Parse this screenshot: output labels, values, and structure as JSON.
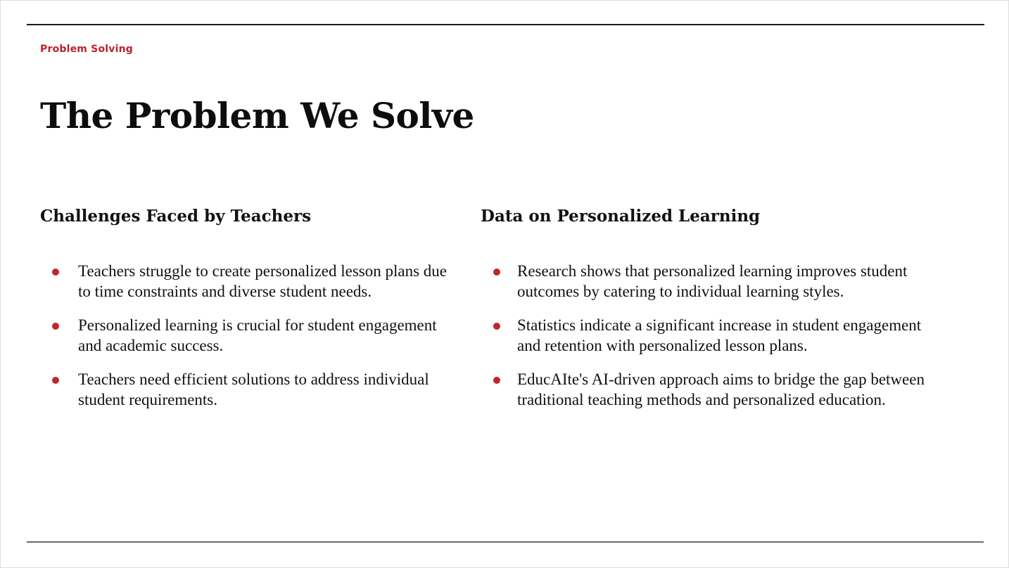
{
  "slide": {
    "eyebrow": "Problem Solving",
    "title": "The Problem We Solve",
    "accent_color": "#c0202a",
    "bullet_color": "#c0262b",
    "rule_top_color": "#1a1a1a",
    "rule_bottom_color": "#6a6a6a",
    "background_color": "#ffffff",
    "text_color": "#111111"
  },
  "columns": [
    {
      "heading": "Challenges Faced by Teachers",
      "bullets": [
        "Teachers struggle to create personalized lesson plans due to time constraints and diverse student needs.",
        "Personalized learning is crucial for student engagement and academic success.",
        "Teachers need efficient solutions to address individual student requirements."
      ]
    },
    {
      "heading": "Data on Personalized Learning",
      "bullets": [
        "Research shows that personalized learning improves student outcomes by catering to individual learning styles.",
        "Statistics indicate a significant increase in student engagement and retention with personalized lesson plans.",
        "EducAIte's AI-driven approach aims to bridge the gap between traditional teaching methods and personalized education."
      ]
    }
  ]
}
